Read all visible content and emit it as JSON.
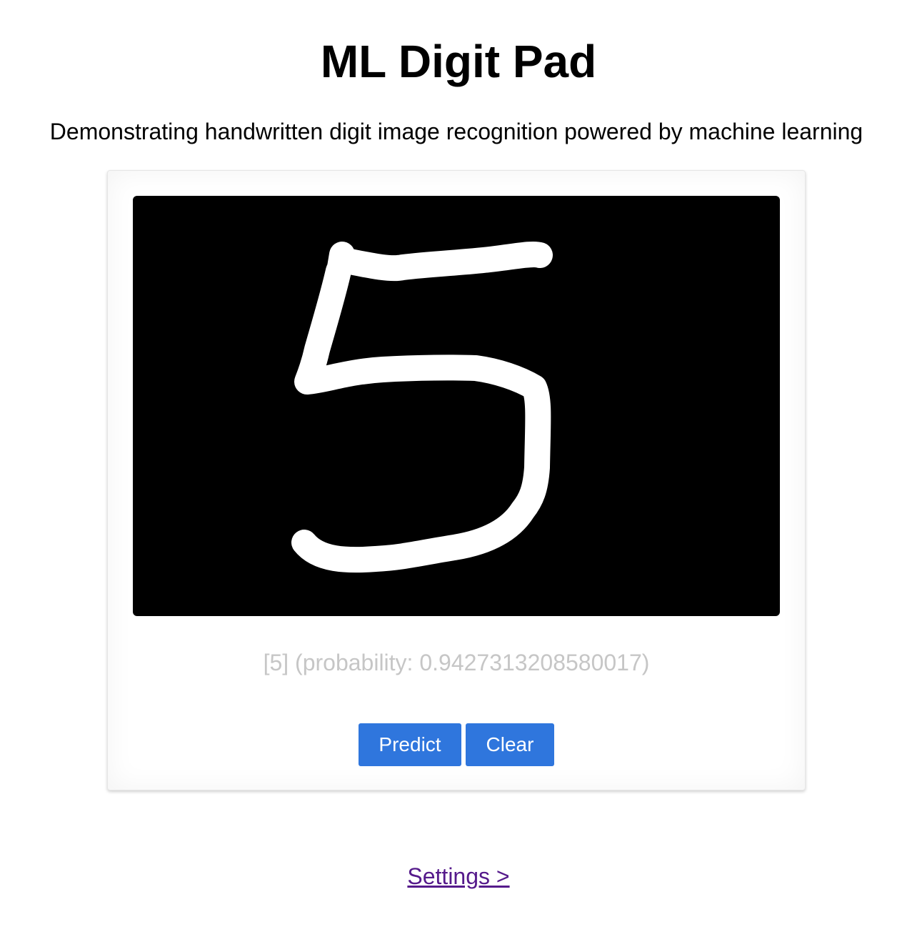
{
  "header": {
    "title": "ML Digit Pad",
    "subtitle": "Demonstrating handwritten digit image recognition powered by machine learning"
  },
  "pad": {
    "prediction_text": "[5] (probability: 0.9427313208580017)",
    "predicted_digit": 5,
    "probability": 0.9427313208580017
  },
  "actions": {
    "predict_label": "Predict",
    "clear_label": "Clear"
  },
  "footer": {
    "settings_link": "Settings >"
  },
  "colors": {
    "canvas_background": "#000000",
    "stroke": "#ffffff",
    "button": "#2f76dd",
    "link": "#551a8b",
    "prediction_text": "#c6c6c6"
  }
}
